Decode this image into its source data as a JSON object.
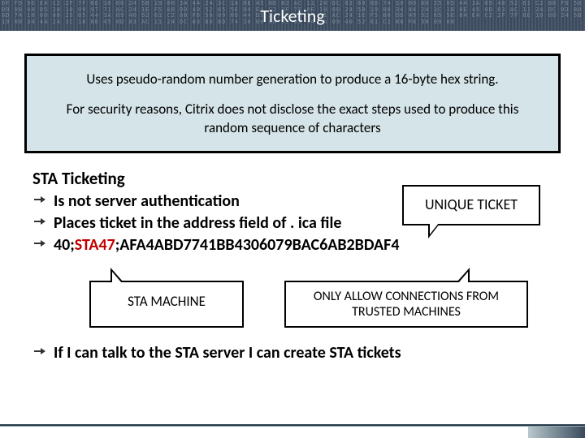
{
  "header": {
    "title": "Ticketing",
    "hex_bg": "0F F9 9E E4 C2 2F 7F 8E 10 00 24 5B 19 00 34 44 24 3C 18 8E 45 0D 83 AC 11 24 DC 03 80 8D 74 10 00 08 25 05 44 3A 09 40 52 61 C2 88 F6 50 09 08 44 D5 24 10 09 97 71 AC 24 1E F5 60 DD 49 52 65 5E 84 E4 C2 2F 7F 8E 10 00 24 5B 19 00 34 44 24 3C 18 8E 45 0D 83 AC 11 24 DC 03 80 8D 74 10 00 08 25 05 44 3A 09 40 52 61 C2 88 F6 50 09 08 44 D5 24 10 09 97 71 AC 24 1E F5 60 DD 49 52 65 5E 84 E4 C2 2F 7F 8E 10 00 24 5B 19 00 34 44 24 3C 18 8E 45 0D 83 AC 11 24 DC 03 80 8D 74 10 00 08 25 05 44 3A 09 40 52 61 C2 88 F6 50 09 08"
  },
  "info": {
    "line1": "Uses pseudo-random number generation to produce a 16-byte hex string.",
    "line2": "For security reasons, Citrix does not disclose the exact steps used to produce this random sequence of characters"
  },
  "section": {
    "title": "STA Ticketing",
    "bullets": [
      "Is not server authentication",
      "Places ticket in the address field of . ica file"
    ],
    "ticket_prefix": "40;",
    "ticket_mid": "STA47",
    "ticket_suffix": ";AFA4ABD7741BB4306079BAC6AB2BDAF4"
  },
  "callouts": {
    "unique": "UNIQUE TICKET",
    "sta": "STA MACHINE",
    "trust": "ONLY ALLOW CONNECTIONS FROM TRUSTED MACHINES"
  },
  "final": "If I can talk to the STA server I can create STA tickets"
}
